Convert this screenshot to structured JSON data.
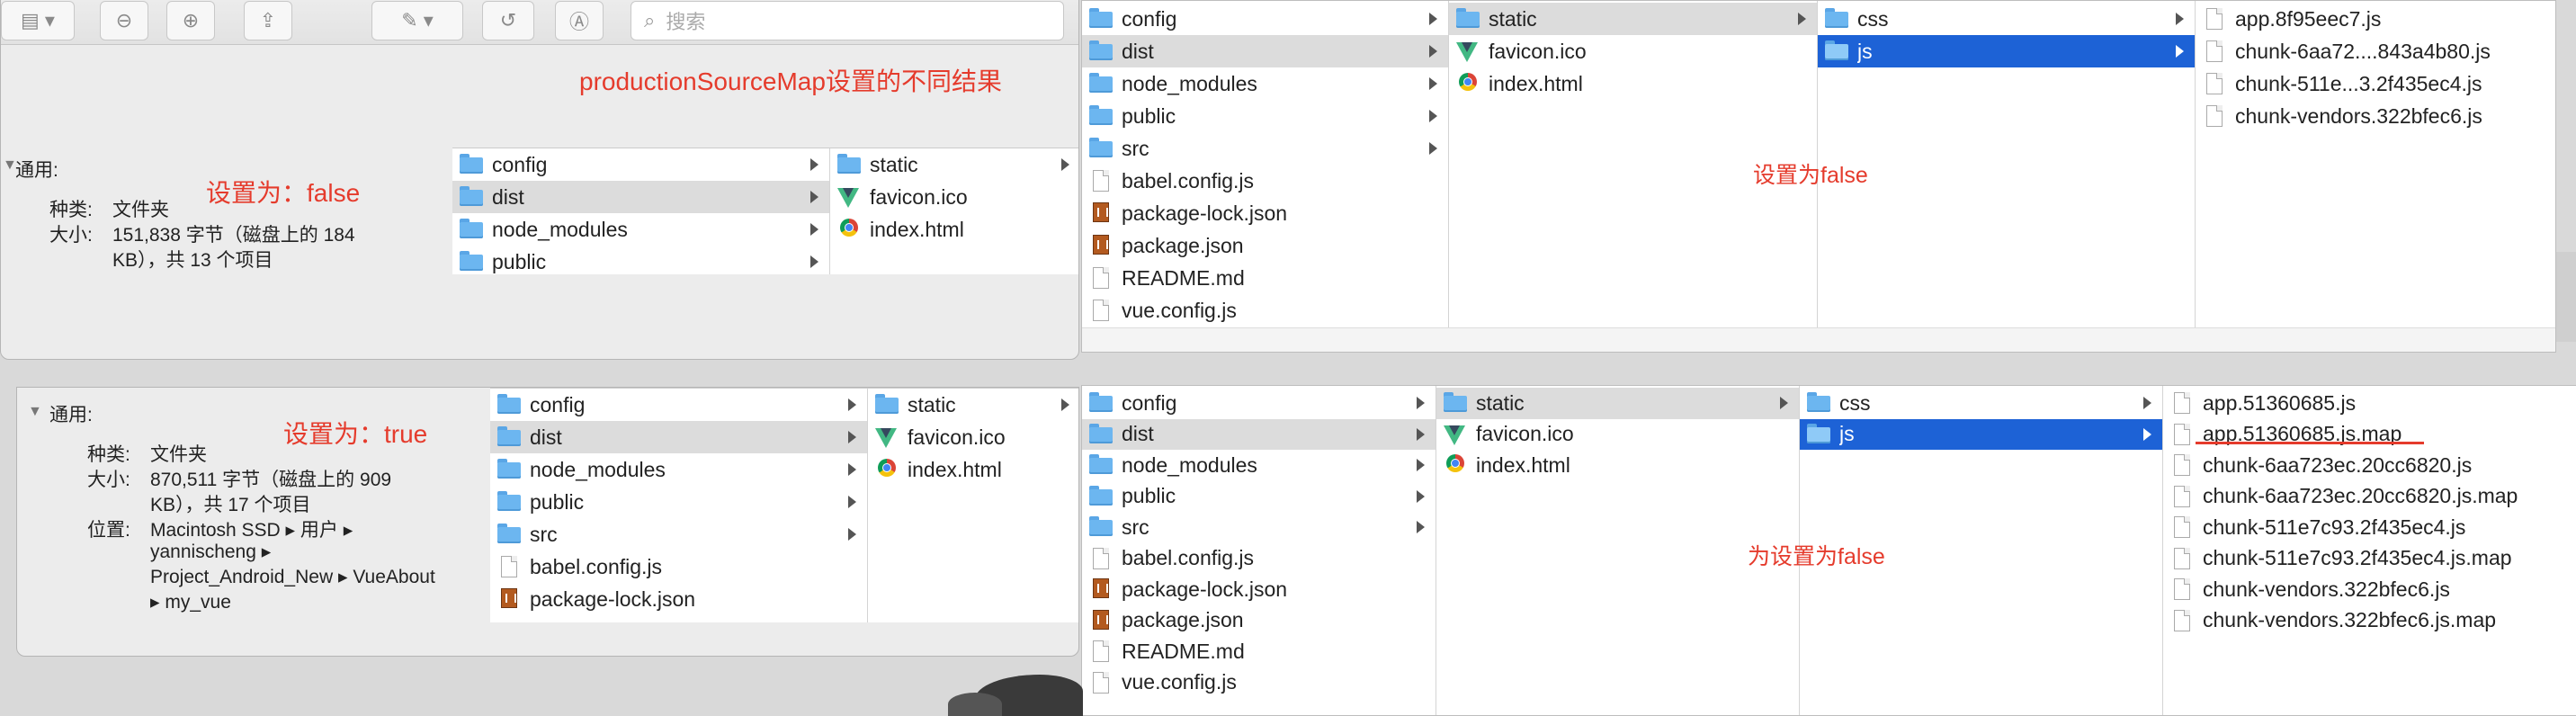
{
  "toolbar": {
    "search_placeholder": "搜索"
  },
  "caption": "productionSourceMap设置的不同结果",
  "info_top": {
    "section": "通用:",
    "kind_label": "种类:",
    "kind_value": "文件夹",
    "size_label": "大小:",
    "size_value_1": "151,838 字节（磁盘上的 184",
    "size_value_2": "KB），共 13 个项目",
    "setting_label": "设置为：false"
  },
  "info_bottom": {
    "section": "通用:",
    "kind_label": "种类:",
    "kind_value": "文件夹",
    "size_label": "大小:",
    "size_value_1": "870,511 字节（磁盘上的 909",
    "size_value_2": "KB），共 17 个项目",
    "location_label": "位置:",
    "location_1": "Macintosh SSD ▸ 用户 ▸",
    "location_2": "yannischeng ▸",
    "location_3": "Project_Android_New ▸ VueAbout",
    "location_4": "▸ my_vue",
    "setting_label": "设置为：true"
  },
  "label_right_top": "设置为false",
  "label_right_bottom": "为设置为false",
  "small_top": {
    "col1": [
      "config",
      "dist",
      "node_modules",
      "public"
    ],
    "col2": [
      "static",
      "favicon.ico",
      "index.html"
    ]
  },
  "small_bottom": {
    "col1": [
      "config",
      "dist",
      "node_modules",
      "public",
      "src",
      "babel.config.js",
      "package-lock.json"
    ],
    "col2": [
      "static",
      "favicon.ico",
      "index.html"
    ]
  },
  "right_top": {
    "col1": [
      "config",
      "dist",
      "node_modules",
      "public",
      "src",
      "babel.config.js",
      "package-lock.json",
      "package.json",
      "README.md",
      "vue.config.js"
    ],
    "col2": [
      "static",
      "favicon.ico",
      "index.html"
    ],
    "col3": [
      "css",
      "js"
    ],
    "col4": [
      "app.8f95eec7.js",
      "chunk-6aa72....843a4b80.js",
      "chunk-511e...3.2f435ec4.js",
      "chunk-vendors.322bfec6.js"
    ]
  },
  "right_bottom": {
    "col1": [
      "config",
      "dist",
      "node_modules",
      "public",
      "src",
      "babel.config.js",
      "package-lock.json",
      "package.json",
      "README.md",
      "vue.config.js"
    ],
    "col2": [
      "static",
      "favicon.ico",
      "index.html"
    ],
    "col3": [
      "css",
      "js"
    ],
    "col4": [
      "app.51360685.js",
      "app.51360685.js.map",
      "chunk-6aa723ec.20cc6820.js",
      "chunk-6aa723ec.20cc6820.js.map",
      "chunk-511e7c93.2f435ec4.js",
      "chunk-511e7c93.2f435ec4.js.map",
      "chunk-vendors.322bfec6.js",
      "chunk-vendors.322bfec6.js.map"
    ]
  },
  "colors": {
    "annotation_red": "#e53b2c",
    "selection_blue": "#1d62d6",
    "selection_gray": "#dcdcdc"
  }
}
